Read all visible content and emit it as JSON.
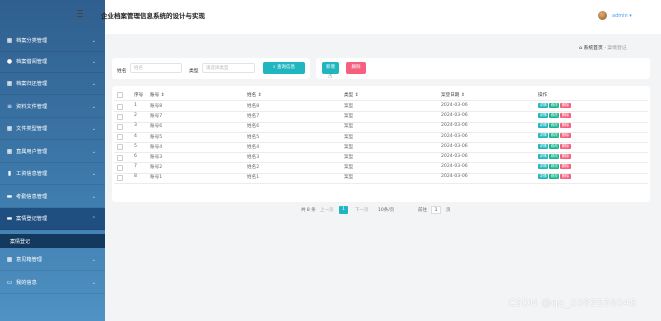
{
  "app": {
    "title": "企业档案管理信息系统的设计与实现",
    "user": "admin",
    "user_caret": "▾"
  },
  "sidebar": {
    "items": [
      {
        "label": "档案分类管理",
        "icon": "grid-icon"
      },
      {
        "label": "档案借阅管理",
        "icon": "user-icon"
      },
      {
        "label": "档案归还管理",
        "icon": "grid-icon"
      },
      {
        "label": "资料文件管理",
        "icon": "stack-icon"
      },
      {
        "label": "文件类型管理",
        "icon": "grid-icon"
      },
      {
        "label": "直属用户管理",
        "icon": "grid-icon"
      },
      {
        "label": "工资信息管理",
        "icon": "chart-icon"
      },
      {
        "label": "考勤信息管理",
        "icon": "folder-icon"
      },
      {
        "label": "案情登记管理",
        "icon": "folder-icon"
      },
      {
        "label": "意见箱管理",
        "icon": "grid-icon"
      },
      {
        "label": "我的信息",
        "icon": "card-icon"
      }
    ],
    "sub_item": "案情登记"
  },
  "breadcrumb": {
    "home": "系统首页",
    "sep": "·",
    "current": "案情登记"
  },
  "search": {
    "name_label": "姓名",
    "name_placeholder": "姓名",
    "type_label": "类型",
    "type_placeholder": "请选择类型",
    "search_button": "查询信息"
  },
  "actions": {
    "add": "新增",
    "delete": "删除"
  },
  "table": {
    "columns": [
      "序号",
      "账号 ⇕",
      "姓名 ⇕",
      "类型 ⇕",
      "案登日期 ⇕",
      "操作"
    ],
    "rows": [
      {
        "idx": "1",
        "account": "账号8",
        "name": "姓名8",
        "type": "案型",
        "date": "2024-03-06"
      },
      {
        "idx": "2",
        "account": "账号7",
        "name": "姓名7",
        "type": "案型",
        "date": "2024-03-06"
      },
      {
        "idx": "3",
        "account": "账号6",
        "name": "姓名6",
        "type": "案型",
        "date": "2024-03-06"
      },
      {
        "idx": "4",
        "account": "账号5",
        "name": "姓名5",
        "type": "案型",
        "date": "2024-03-06"
      },
      {
        "idx": "5",
        "account": "账号4",
        "name": "姓名4",
        "type": "案型",
        "date": "2024-03-06"
      },
      {
        "idx": "6",
        "account": "账号3",
        "name": "姓名3",
        "type": "案型",
        "date": "2024-03-06"
      },
      {
        "idx": "7",
        "account": "账号2",
        "name": "姓名2",
        "type": "案型",
        "date": "2024-03-06"
      },
      {
        "idx": "8",
        "account": "账号1",
        "name": "姓名1",
        "type": "案型",
        "date": "2024-03-06"
      }
    ],
    "ops": {
      "detail": "详情",
      "modify": "修改",
      "remove": "删除"
    }
  },
  "pagination": {
    "total": "共 8 条",
    "prev": "上一页",
    "current": "1",
    "next": "下一页",
    "per_page": "10条/页",
    "goto_label": "前往",
    "goto_value": "1",
    "page_unit": "页"
  },
  "watermark": "CSDN @qq_2083558048",
  "colors": {
    "accent": "#1fb6c0",
    "danger": "#f5607e",
    "sidebar": "#2f5f8e",
    "sidebar_open": "#1f4e80"
  }
}
